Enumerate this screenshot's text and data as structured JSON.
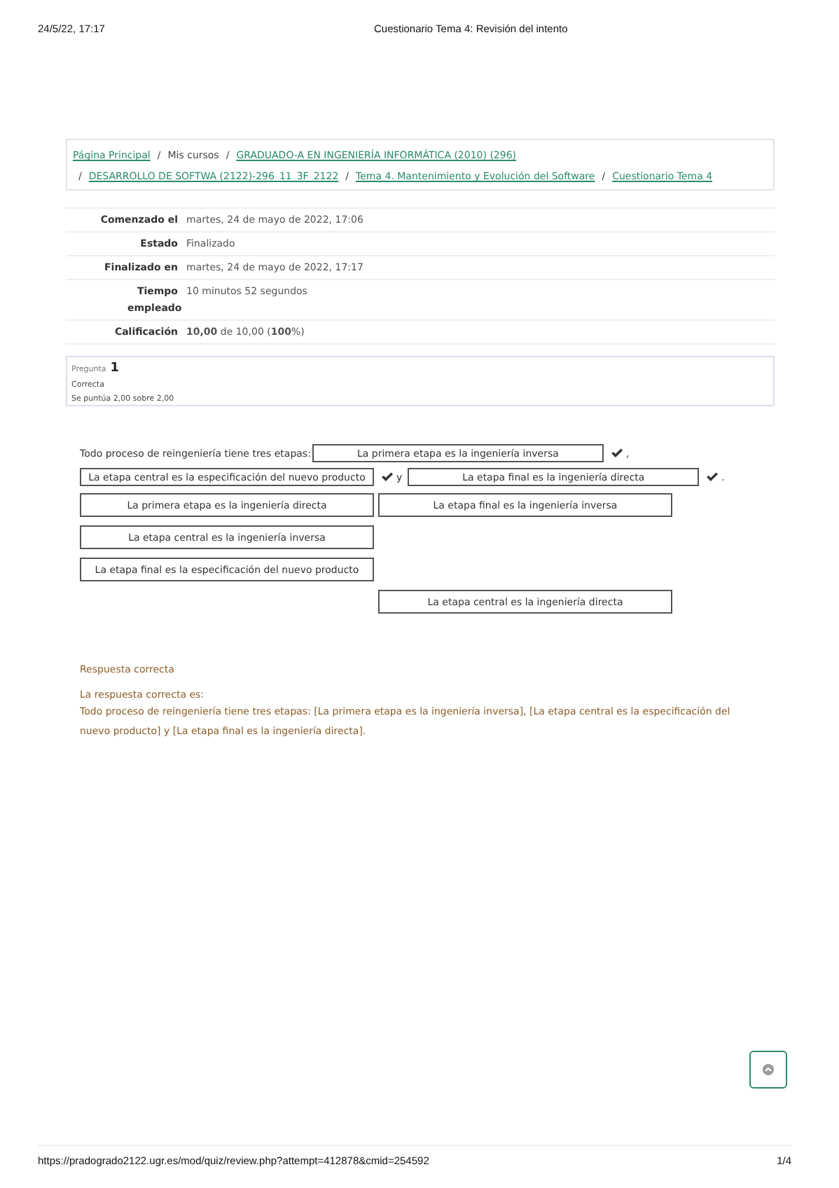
{
  "print_header": {
    "date": "24/5/22, 17:17",
    "title": "Cuestionario Tema 4: Revisión del intento"
  },
  "breadcrumb": [
    {
      "kind": "link",
      "text": "Página Principal"
    },
    {
      "kind": "separator",
      "text": "/"
    },
    {
      "kind": "text",
      "text": "Mis cursos"
    },
    {
      "kind": "separator",
      "text": "/"
    },
    {
      "kind": "link",
      "text": "GRADUADO-A EN INGENIERÍA INFORMÁTICA (2010) (296)"
    },
    {
      "kind": "break"
    },
    {
      "kind": "separator",
      "text": "/"
    },
    {
      "kind": "link",
      "text": "DESARROLLO DE SOFTWA (2122)-296_11_3F_2122"
    },
    {
      "kind": "separator",
      "text": "/"
    },
    {
      "kind": "link",
      "text": "Tema 4. Mantenimiento y Evolución del Software"
    },
    {
      "kind": "separator",
      "text": "/"
    },
    {
      "kind": "link",
      "text": "Cuestionario Tema 4"
    }
  ],
  "summary": [
    {
      "label": "Comenzado el",
      "value": "martes, 24 de mayo de 2022, 17:06"
    },
    {
      "label": "Estado",
      "value": "Finalizado"
    },
    {
      "label": "Finalizado en",
      "value": "martes, 24 de mayo de 2022, 17:17"
    },
    {
      "label": "Tiempo empleado",
      "value": "10 minutos 52 segundos"
    },
    {
      "label": "Calificación",
      "value": "**10,00** de 10,00 (**100**%)"
    }
  ],
  "question_info": {
    "label": "Pregunta",
    "number": "1",
    "state": "Correcta",
    "grade": "Se puntúa 2,00 sobre 2,00"
  },
  "question_text": [
    {
      "kind": "text",
      "text": "Todo proceso de reingeniería tiene tres etapas:"
    },
    {
      "kind": "drop",
      "text": "La primera etapa es la ingeniería inversa",
      "correct": true
    },
    {
      "kind": "text",
      "text": ","
    },
    {
      "kind": "break"
    },
    {
      "kind": "drop",
      "text": "La etapa central  es la especificación del nuevo producto",
      "correct": true
    },
    {
      "kind": "text",
      "text": "y"
    },
    {
      "kind": "drop",
      "text": "La etapa final es la ingeniería directa",
      "correct": true
    },
    {
      "kind": "text",
      "text": "."
    }
  ],
  "choices": [
    {
      "kind": "choice",
      "text": "La primera etapa es la ingeniería directa"
    },
    {
      "kind": "choice",
      "text": "La etapa final es la ingeniería inversa"
    },
    {
      "kind": "choice",
      "text": "La etapa central es la ingeniería inversa"
    },
    {
      "kind": "empty"
    },
    {
      "kind": "choice",
      "text": "La etapa final  es la especificación del nuevo producto"
    },
    {
      "kind": "empty"
    },
    {
      "kind": "empty"
    },
    {
      "kind": "choice",
      "text": "La etapa central es la ingeniería directa"
    }
  ],
  "feedback": {
    "status": "Respuesta correcta",
    "intro": "La respuesta correcta es:",
    "answer": "Todo proceso de reingeniería tiene tres etapas: [La primera etapa es la ingeniería inversa], [La etapa central es la especificación del nuevo producto] y [La etapa final es la ingeniería directa]."
  },
  "print_footer": {
    "url": "https://pradogrado2122.ugr.es/mod/quiz/review.php?attempt=412878&cmid=254592",
    "page": "1/4"
  }
}
